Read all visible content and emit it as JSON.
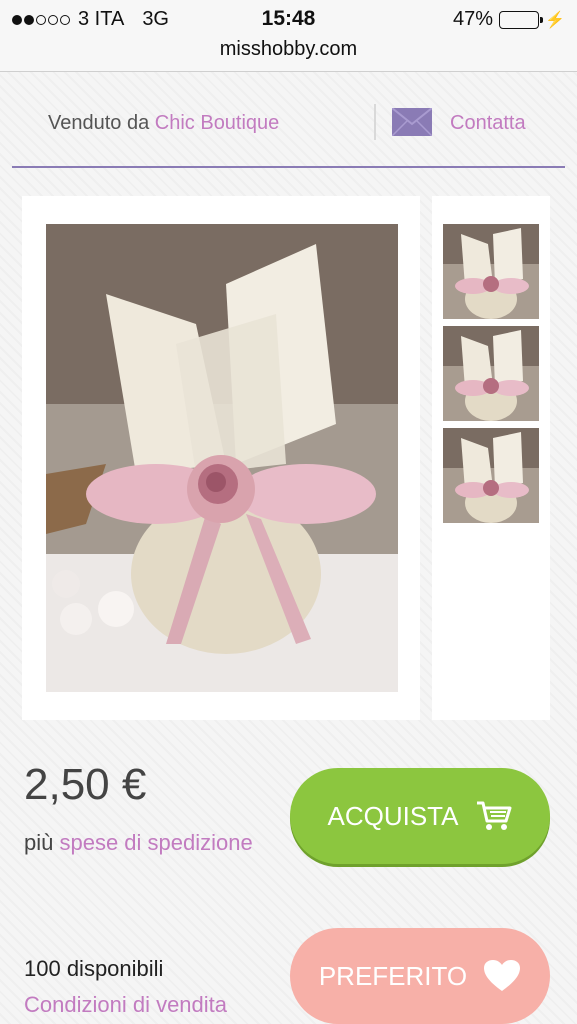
{
  "status_bar": {
    "carrier": "3 ITA",
    "network": "3G",
    "time": "15:48",
    "battery": "47%",
    "battery_level": 0.47,
    "signal_bars_filled": 2,
    "signal_bars_total": 5,
    "url": "misshobby.com"
  },
  "seller": {
    "prefix": "Venduto da",
    "shop_name": "Chic Boutique",
    "contact_label": "Contatta",
    "contact_icon": "envelope-icon"
  },
  "gallery": {
    "main_image_alt": "burlap favor bag with pink ribbon and rose",
    "thumbnail_count": 3
  },
  "product": {
    "price": "2,50 €",
    "shipping_prefix": "più",
    "shipping_link": "spese di spedizione",
    "availability": "100 disponibili",
    "conditions_link": "Condizioni di vendita"
  },
  "actions": {
    "buy_label": "ACQUISTA",
    "buy_icon": "cart-icon",
    "favorite_label": "PREFERITO",
    "favorite_icon": "heart-icon"
  },
  "colors": {
    "accent_link": "#c27bc0",
    "buy_button": "#8cc63f",
    "favorite_button": "#f7b0a8",
    "divider": "#8a7bb5"
  }
}
